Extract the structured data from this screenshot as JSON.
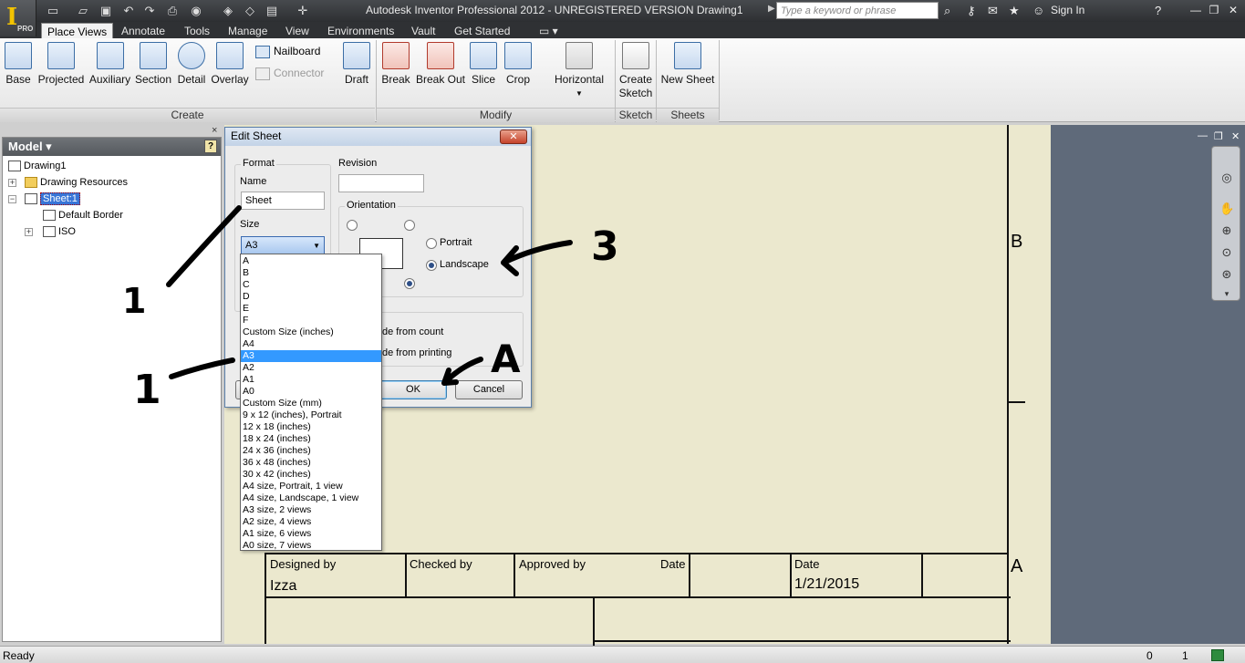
{
  "window": {
    "title": "Autodesk Inventor Professional 2012 - UNREGISTERED VERSION   Drawing1",
    "app_logo": "I",
    "app_badge": "PRO",
    "search_placeholder": "Type a keyword or phrase",
    "sign_in": "Sign In",
    "help_icon": "?"
  },
  "tabs": [
    {
      "label": "Place Views",
      "active": true
    },
    {
      "label": "Annotate"
    },
    {
      "label": "Tools"
    },
    {
      "label": "Manage"
    },
    {
      "label": "View"
    },
    {
      "label": "Environments"
    },
    {
      "label": "Vault"
    },
    {
      "label": "Get Started"
    }
  ],
  "ribbon": {
    "create": {
      "label": "Create",
      "buttons": [
        "Base",
        "Projected",
        "Auxiliary",
        "Section",
        "Detail",
        "Overlay"
      ],
      "small": {
        "nailboard": "Nailboard",
        "connector": "Connector"
      }
    },
    "modify": {
      "label": "Modify",
      "buttons": [
        "Draft",
        "Break",
        "Break Out",
        "Slice",
        "Crop",
        "Horizontal"
      ]
    },
    "sketch": {
      "label": "Sketch",
      "button_line1": "Create",
      "button_line2": "Sketch"
    },
    "sheets": {
      "label": "Sheets",
      "button": "New Sheet"
    }
  },
  "browser": {
    "title": "Model ▾",
    "help": "?",
    "close": "×",
    "items": {
      "root": "Drawing1",
      "resources": "Drawing Resources",
      "sheet": "Sheet:1",
      "border": "Default Border",
      "view": "ISO"
    }
  },
  "canvas": {
    "zone_b": "B",
    "zone_a": "A",
    "title_block": {
      "designed_by_label": "Designed by",
      "designed_by_value": "Izza",
      "checked_by_label": "Checked by",
      "approved_by_label": "Approved by",
      "date_label_1": "Date",
      "date_label_2": "Date",
      "date_value": "1/21/2015"
    }
  },
  "dialog": {
    "title": "Edit Sheet",
    "close": "✕",
    "format_group": "Format",
    "name_label": "Name",
    "name_value": "Sheet",
    "size_label": "Size",
    "size_value": "A3",
    "revision_label": "Revision",
    "revision_value": "",
    "orientation_group": "Orientation",
    "portrait": "Portrait",
    "landscape": "Landscape",
    "orientation_selected": "Landscape",
    "option_count": "de from count",
    "option_printing": "de from printing",
    "ok": "OK",
    "cancel": "Cancel",
    "size_options": [
      "A",
      "B",
      "C",
      "D",
      "E",
      "F",
      "Custom Size (inches)",
      "A4",
      "A3",
      "A2",
      "A1",
      "A0",
      "Custom Size (mm)",
      "9 x 12 (inches), Portrait",
      "12 x 18 (inches)",
      "18 x 24 (inches)",
      "24 x 36 (inches)",
      "36 x 48 (inches)",
      "30 x 42 (inches)",
      "A4 size, Portrait, 1 view",
      "A4 size, Landscape, 1 view",
      "A3 size, 2 views",
      "A2 size, 4 views",
      "A1 size, 6 views",
      "A0 size, 7 views"
    ],
    "selected_option": "A3"
  },
  "annotations": {
    "one_a": "1",
    "one_b": "1",
    "three": "3",
    "a": "A"
  },
  "status": {
    "text": "Ready",
    "count1": "0",
    "count2": "1"
  },
  "colors": {
    "accent": "#3399ff",
    "canvas": "#ebe8ce",
    "ribbon_icon": "#3c6ea5"
  }
}
